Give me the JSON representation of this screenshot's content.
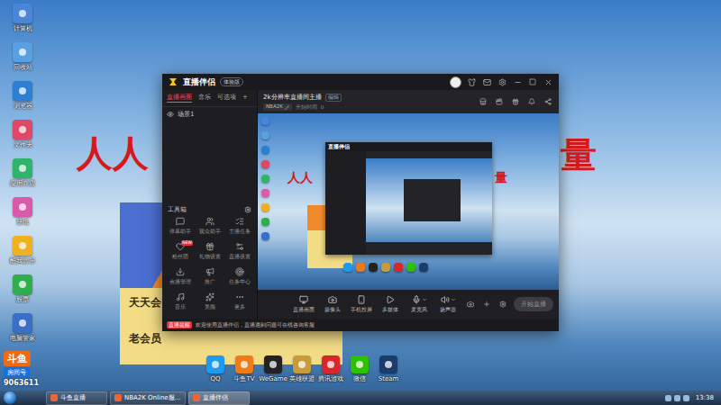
{
  "desktop": {
    "icons": [
      {
        "label": "计算机",
        "color": "#4a86d8"
      },
      {
        "label": "回收站",
        "color": "#5aa0e0"
      },
      {
        "label": "浏览器",
        "color": "#2d7fd3"
      },
      {
        "label": "文件夹",
        "color": "#e0486a"
      },
      {
        "label": "应用商店",
        "color": "#2fb56b"
      },
      {
        "label": "壁纸",
        "color": "#d85aa8"
      },
      {
        "label": "酷我音乐",
        "color": "#f0b020"
      },
      {
        "label": "股票",
        "color": "#2fae4e"
      },
      {
        "label": "电脑管家",
        "color": "#3a6fc8"
      }
    ],
    "wallpaper_text": [
      "人人",
      "量"
    ],
    "poster": {
      "lines": [
        "天天会",
        "老会员"
      ]
    },
    "watermark": {
      "logo": "斗鱼",
      "caption": "房间号",
      "room": "9063611"
    },
    "dock": [
      {
        "label": "QQ",
        "color": "#1d9bf0"
      },
      {
        "label": "斗鱼TV",
        "color": "#f07a1a"
      },
      {
        "label": "WeGame",
        "color": "#222222"
      },
      {
        "label": "英雄联盟",
        "color": "#c89b3c"
      },
      {
        "label": "腾讯游戏",
        "color": "#d8262a"
      },
      {
        "label": "微信",
        "color": "#2dc100"
      },
      {
        "label": "Steam",
        "color": "#1b3d6e"
      }
    ]
  },
  "window": {
    "title": "直播伴侣",
    "badge": "体验版",
    "panel_tabs": [
      {
        "label": "直播画面",
        "selected": true
      },
      {
        "label": "音乐",
        "selected": false
      },
      {
        "label": "可选项",
        "selected": false
      },
      {
        "label": "+",
        "selected": false
      }
    ],
    "scenes": [
      {
        "label": "场景1",
        "visible": true
      }
    ],
    "toolbox": {
      "title": "工具箱",
      "tools": [
        {
          "label": "弹幕助手",
          "badge": ""
        },
        {
          "label": "观众助手",
          "badge": ""
        },
        {
          "label": "主播任务",
          "badge": ""
        },
        {
          "label": "粉丝团",
          "badge": "NEW"
        },
        {
          "label": "礼物设置",
          "badge": ""
        },
        {
          "label": "直播设置",
          "badge": ""
        },
        {
          "label": "点播管理",
          "badge": ""
        },
        {
          "label": "推广",
          "badge": ""
        },
        {
          "label": "任务中心",
          "badge": ""
        },
        {
          "label": "音乐",
          "badge": ""
        },
        {
          "label": "美颜",
          "badge": ""
        },
        {
          "label": "更多",
          "badge": ""
        }
      ]
    },
    "stream": {
      "title": "2k分辨率直播间主播",
      "edit": "编辑",
      "category": "NBA2K",
      "meta": "开始时间",
      "count": "0"
    },
    "preview": {
      "wallpaper_text": [
        "人人",
        "量"
      ],
      "window_title": "直播伴侣"
    },
    "controls": [
      {
        "label": "直播画面",
        "dropdown": false
      },
      {
        "label": "摄像头",
        "dropdown": false
      },
      {
        "label": "手机投屏",
        "dropdown": false
      },
      {
        "label": "多媒体",
        "dropdown": false
      },
      {
        "label": "麦克风",
        "dropdown": true
      },
      {
        "label": "扬声器",
        "dropdown": true
      }
    ],
    "start_button": {
      "label": "开始直播",
      "disabled": true
    },
    "notice": {
      "tag": "直播提醒",
      "text": "欢迎使用直播伴侣，直播遇到问题可在线咨询客服"
    }
  },
  "taskbar": {
    "items": [
      {
        "label": "斗鱼直播",
        "active": false
      },
      {
        "label": "NBA2K Online服…",
        "active": false
      },
      {
        "label": "直播伴侣",
        "active": true
      }
    ],
    "time": "13:38"
  }
}
